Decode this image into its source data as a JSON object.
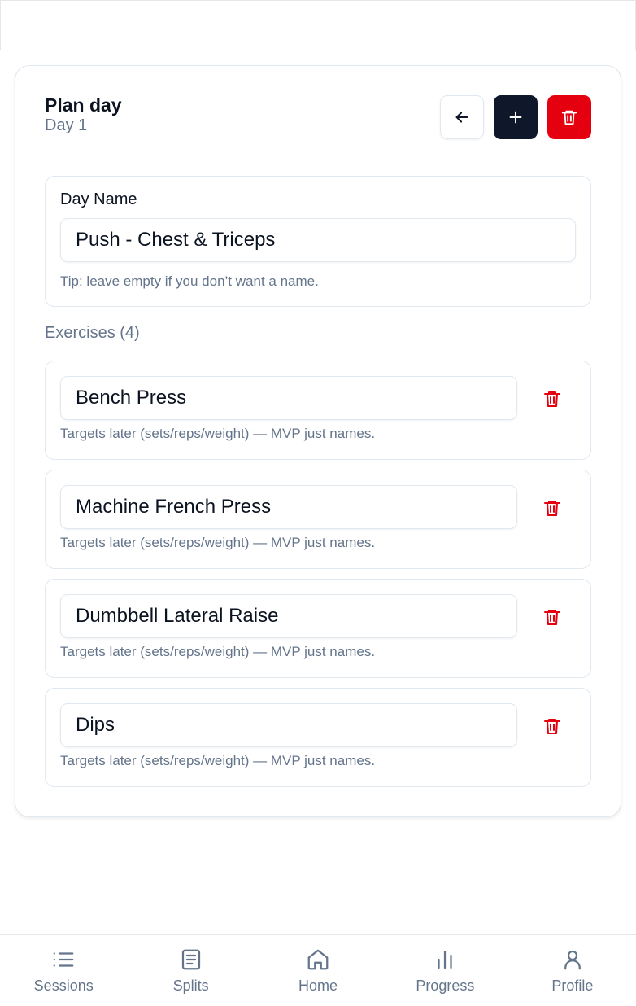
{
  "header": {
    "title": "Plan day",
    "subtitle": "Day 1"
  },
  "day_name": {
    "label": "Day Name",
    "value": "Push - Chest & Triceps",
    "tip": "Tip: leave empty if you don’t want a name."
  },
  "exercises": {
    "heading": "Exercises (4)",
    "items": [
      {
        "name": "Bench Press",
        "hint": "Targets later (sets/reps/weight) — MVP just names."
      },
      {
        "name": "Machine French Press",
        "hint": "Targets later (sets/reps/weight) — MVP just names."
      },
      {
        "name": "Dumbbell Lateral Raise",
        "hint": "Targets later (sets/reps/weight) — MVP just names."
      },
      {
        "name": "Dips",
        "hint": "Targets later (sets/reps/weight) — MVP just names."
      }
    ]
  },
  "nav": {
    "items": [
      {
        "label": "Sessions",
        "icon": "list-icon"
      },
      {
        "label": "Splits",
        "icon": "notes-icon"
      },
      {
        "label": "Home",
        "icon": "home-icon"
      },
      {
        "label": "Progress",
        "icon": "bar-chart-icon"
      },
      {
        "label": "Profile",
        "icon": "user-icon"
      }
    ]
  },
  "colors": {
    "primary": "#0f172a",
    "danger": "#e5000f",
    "muted": "#64748b",
    "border": "#e2e8f0"
  }
}
